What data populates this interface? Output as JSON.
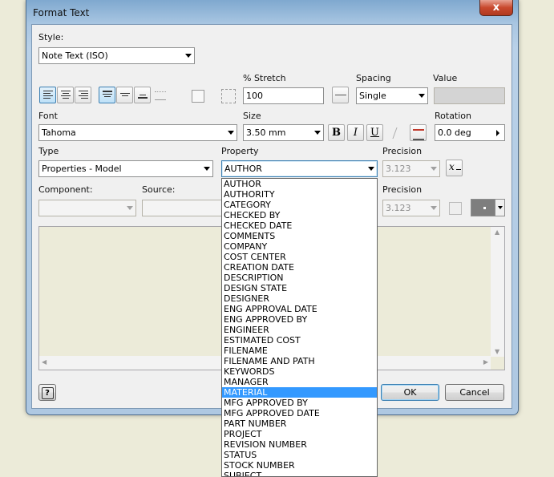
{
  "window": {
    "title": "Format Text",
    "close_glyph": "x"
  },
  "style": {
    "label": "Style:",
    "value": "Note Text (ISO)"
  },
  "stretch": {
    "label": "% Stretch",
    "value": "100"
  },
  "spacing": {
    "label": "Spacing",
    "value": "Single"
  },
  "value_field": {
    "label": "Value",
    "value": ""
  },
  "font": {
    "label": "Font",
    "value": "Tahoma"
  },
  "size": {
    "label": "Size",
    "value": "3.50 mm"
  },
  "format_buttons": {
    "bold": "B",
    "italic": "I",
    "underline": "U"
  },
  "rotation": {
    "label": "Rotation",
    "value": "0.0 deg"
  },
  "type": {
    "label": "Type",
    "value": "Properties - Model"
  },
  "property": {
    "label": "Property",
    "value": "AUTHOR",
    "options": [
      "AUTHOR",
      "AUTHORITY",
      "CATEGORY",
      "CHECKED BY",
      "CHECKED DATE",
      "COMMENTS",
      "COMPANY",
      "COST CENTER",
      "CREATION DATE",
      "DESCRIPTION",
      "DESIGN STATE",
      "DESIGNER",
      "ENG APPROVAL DATE",
      "ENG APPROVED BY",
      "ENGINEER",
      "ESTIMATED COST",
      "FILENAME",
      "FILENAME AND PATH",
      "KEYWORDS",
      "MANAGER",
      "MATERIAL",
      "MFG APPROVED BY",
      "MFG APPROVED DATE",
      "PART NUMBER",
      "PROJECT",
      "REVISION NUMBER",
      "STATUS",
      "STOCK NUMBER",
      "SUBJECT"
    ],
    "highlighted": "MATERIAL"
  },
  "precision1": {
    "label": "Precision",
    "value": "3.123"
  },
  "precision2": {
    "label": "Precision",
    "value": "3.123"
  },
  "component": {
    "label": "Component:",
    "value": ""
  },
  "source": {
    "label": "Source:",
    "value": ""
  },
  "buttons": {
    "ok": "OK",
    "cancel": "Cancel",
    "help": "?"
  },
  "colors": {
    "selection": "#3399ff",
    "text_area": "#ecebd9"
  }
}
